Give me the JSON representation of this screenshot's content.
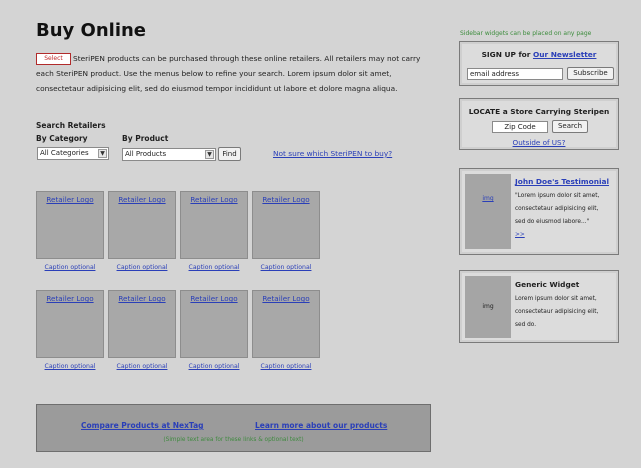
{
  "main": {
    "title": "Buy Online",
    "select_badge": "Select",
    "intro_text": "SteriPEN products can be purchased through these online retailers. All retailers may not carry each SteriPEN product. Use the menus below to refine your search. Lorem ipsum dolor sit amet, consectetaur adipisicing elit, sed do eiusmod tempor incididunt ut labore et dolore magna aliqua.",
    "search_heading": "Search Retailers",
    "by_category_label": "By Category",
    "by_category_value": "All Categories",
    "by_product_label": "By Product",
    "by_product_value": "All Products",
    "find_button": "Find",
    "not_sure_link": "Not sure which SteriPEN to buy?",
    "retailer_logo_text": "Retailer Logo",
    "caption_text": "Caption optional",
    "retailers_row1": [
      {
        "logo": "Retailer Logo",
        "caption": "Caption optional"
      },
      {
        "logo": "Retailer Logo",
        "caption": "Caption optional"
      },
      {
        "logo": "Retailer Logo",
        "caption": "Caption optional"
      },
      {
        "logo": "Retailer Logo",
        "caption": "Caption optional"
      }
    ],
    "retailers_row2": [
      {
        "logo": "Retailer Logo",
        "caption": "Caption optional"
      },
      {
        "logo": "Retailer Logo",
        "caption": "Caption optional"
      },
      {
        "logo": "Retailer Logo",
        "caption": "Caption optional"
      },
      {
        "logo": "Retailer Logo",
        "caption": "Caption optional"
      }
    ],
    "compare_link": "Compare Products at NexTag",
    "learn_more_link": "Learn more about our products",
    "simple_text_note": "(Simple text area for these links & optional text)"
  },
  "sidebar": {
    "note": "Sidebar widgets can be placed on any page",
    "newsletter": {
      "title_prefix": "SIGN UP for ",
      "title_link": "Our Newsletter",
      "email_value": "email address",
      "subscribe_button": "Subscribe"
    },
    "locate": {
      "title": "LOCATE a Store Carrying Steripen",
      "zip_value": "Zip Code",
      "search_button": "Search",
      "outside_link": "Outside of US?"
    },
    "testimonial": {
      "img_label": "img",
      "title": "John Doe's Testimonial",
      "text": "\"Lorem ipsum dolor sit amet, consectetaur adipisicing elit, sed do eiusmod labore...\"",
      "more_link": ">>"
    },
    "generic": {
      "img_label": "img",
      "title": "Generic Widget",
      "text": "Lorem ipsum dolor sit amet, consectetaur adipisicing elit, sed do."
    }
  },
  "colors": {
    "background": "#d4d4d4",
    "link": "#2a3fb8",
    "accent_red": "#c02a2a",
    "note_green": "#3c8c3c"
  }
}
